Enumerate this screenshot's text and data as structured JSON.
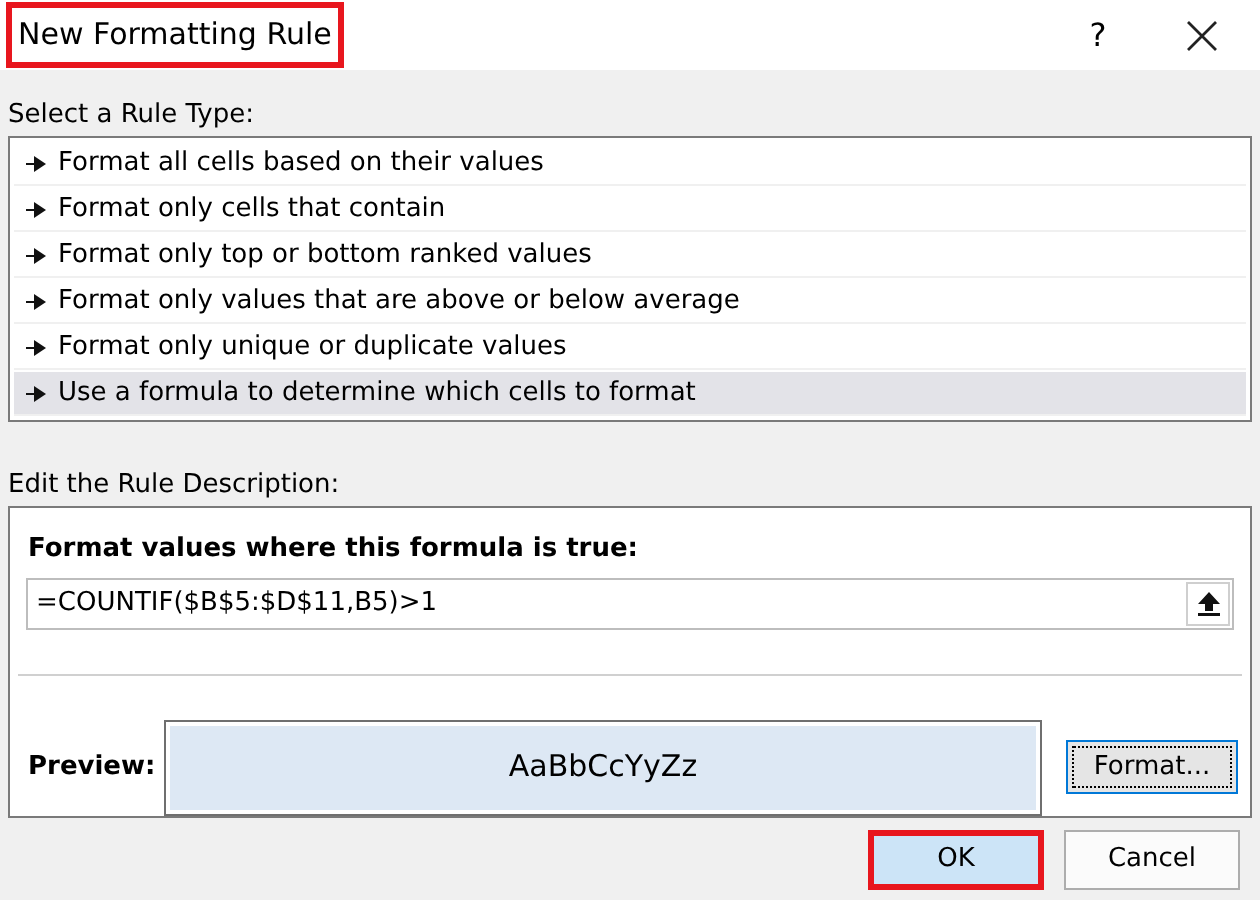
{
  "window": {
    "title": "New Formatting Rule",
    "title_highlighted": true,
    "help": "?"
  },
  "rule_type": {
    "label": "Select a Rule Type:",
    "items": [
      {
        "label": "Format all cells based on their values",
        "selected": false
      },
      {
        "label": "Format only cells that contain",
        "selected": false
      },
      {
        "label": "Format only top or bottom ranked values",
        "selected": false
      },
      {
        "label": "Format only values that are above or below average",
        "selected": false
      },
      {
        "label": "Format only unique or duplicate values",
        "selected": false
      },
      {
        "label": "Use a formula to determine which cells to format",
        "selected": true
      }
    ]
  },
  "description": {
    "label": "Edit the Rule Description:",
    "formula_label": "Format values where this formula is true:",
    "formula": "=COUNTIF($B$5:$D$11,B5)>1",
    "preview_label": "Preview:",
    "preview_sample": "AaBbCcYyZz",
    "format_button": "Format..."
  },
  "buttons": [
    {
      "label": "OK",
      "highlighted": true
    },
    {
      "label": "Cancel",
      "highlighted": false
    }
  ]
}
